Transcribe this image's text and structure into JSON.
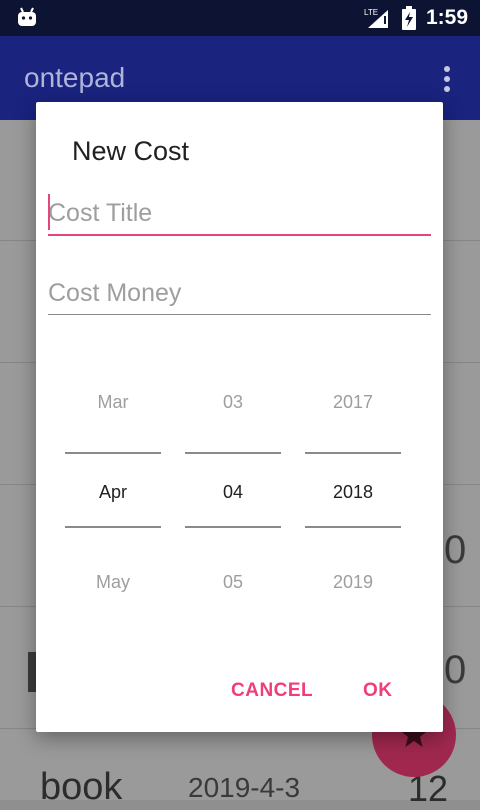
{
  "status_bar": {
    "time": "1:59",
    "network_label": "LTE"
  },
  "app_bar": {
    "title": "ontepad"
  },
  "list": {
    "bottom_row": {
      "name": "book",
      "date": "2019-4-3",
      "amount": "12"
    },
    "peek_amount_1": "0",
    "peek_amount_2": "0"
  },
  "dialog": {
    "title": "New Cost",
    "title_field": {
      "placeholder": "Cost Title",
      "value": ""
    },
    "money_field": {
      "placeholder": "Cost Money",
      "value": ""
    },
    "date_picker": {
      "month": {
        "prev": "Mar",
        "current": "Apr",
        "next": "May"
      },
      "day": {
        "prev": "03",
        "current": "04",
        "next": "05"
      },
      "year": {
        "prev": "2017",
        "current": "2018",
        "next": "2019"
      }
    },
    "cancel_label": "CANCEL",
    "ok_label": "OK"
  },
  "colors": {
    "accent": "#e4467c",
    "primary": "#1a237e",
    "status_bar": "#0d1333"
  }
}
